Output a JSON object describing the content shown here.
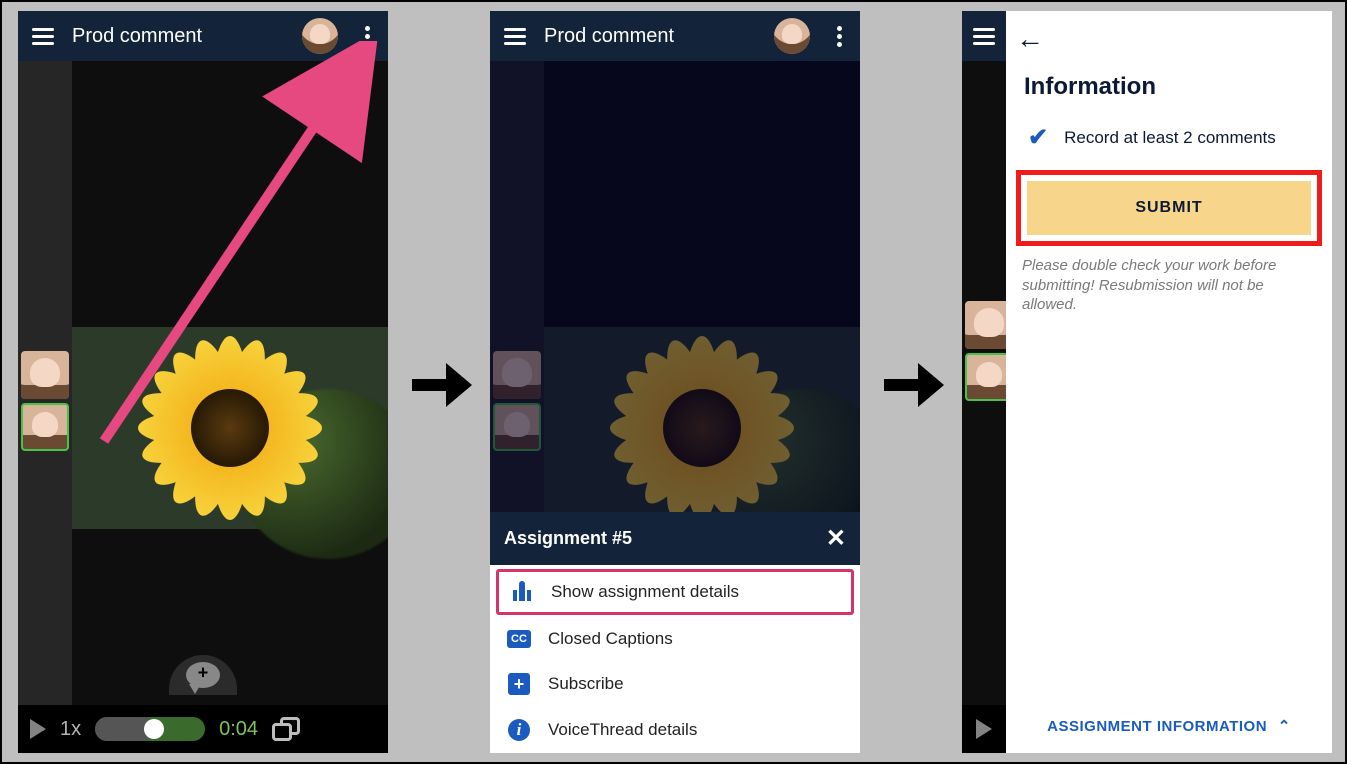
{
  "header": {
    "title": "Prod comment"
  },
  "player": {
    "speed": "1x",
    "time": "0:04"
  },
  "sheet": {
    "title": "Assignment #5",
    "rows": {
      "details": "Show assignment details",
      "cc": "Closed Captions",
      "cc_badge": "CC",
      "subscribe": "Subscribe",
      "vt": "VoiceThread details"
    }
  },
  "info_panel": {
    "title": "Information",
    "requirement": "Record at least 2 comments",
    "submit": "SUBMIT",
    "hint": "Please double check your work before submitting!  Resubmission will not be allowed.",
    "footer": "ASSIGNMENT INFORMATION"
  }
}
